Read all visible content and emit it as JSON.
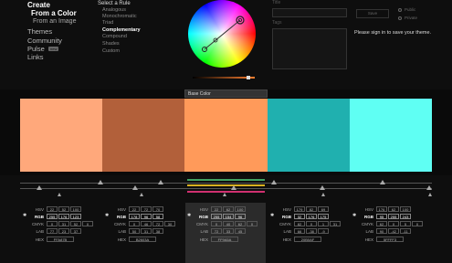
{
  "nav": {
    "create": "Create",
    "from_color": "From a Color",
    "from_image": "From an Image",
    "themes": "Themes",
    "community": "Community",
    "pulse": "Pulse",
    "pulse_badge": "new",
    "links": "Links"
  },
  "rules": {
    "title": "Select a Rule",
    "items": [
      "Analogous",
      "Monochromatic",
      "Triad",
      "Complementary",
      "Compound",
      "Shades",
      "Custom"
    ],
    "active_index": 3
  },
  "form": {
    "title_label": "Title",
    "tags_label": "Tags",
    "save_label": "Save",
    "public_label": "Public",
    "private_label": "Private",
    "signin_text": "Please sign in to save your theme."
  },
  "base_color_label": "Base Color",
  "swatches": [
    {
      "color": "#FFA87B",
      "hex": "FFA87B"
    },
    {
      "color": "#B2603A",
      "hex": "B2603A"
    },
    {
      "color": "#FF9A5A",
      "hex": "FF9A5A"
    },
    {
      "color": "#20B0AF",
      "hex": "20B0AF"
    },
    {
      "color": "#5FFFF3",
      "hex": "5FFFF3"
    }
  ],
  "values": [
    {
      "hsv": [
        "22",
        "52",
        "100"
      ],
      "rgb": [
        "255",
        "176",
        "123"
      ],
      "cmyk": [
        "0",
        "31",
        "52",
        "0"
      ],
      "lab": [
        "77",
        "23",
        "37"
      ],
      "hex": "FFA87B"
    },
    {
      "hsv": [
        "22",
        "72",
        "70"
      ],
      "rgb": [
        "178",
        "96",
        "58"
      ],
      "cmyk": [
        "0",
        "46",
        "72",
        "30"
      ],
      "lab": [
        "50",
        "31",
        "38"
      ],
      "hex": "B2603A"
    },
    {
      "hsv": [
        "22",
        "62",
        "100"
      ],
      "rgb": [
        "255",
        "154",
        "96"
      ],
      "cmyk": [
        "0",
        "40",
        "62",
        "0"
      ],
      "lab": [
        "72",
        "33",
        "45"
      ],
      "hex": "FF9A5A"
    },
    {
      "hsv": [
        "179",
        "82",
        "69"
      ],
      "rgb": [
        "32",
        "176",
        "175"
      ],
      "cmyk": [
        "82",
        "0",
        "1",
        "31"
      ],
      "lab": [
        "66",
        "-38",
        "-9"
      ],
      "hex": "20B0AF"
    },
    {
      "hsv": [
        "176",
        "62",
        "100"
      ],
      "rgb": [
        "95",
        "255",
        "243"
      ],
      "cmyk": [
        "62",
        "0",
        "5",
        "0"
      ],
      "lab": [
        "90",
        "-42",
        "-11"
      ],
      "hex": "5FFFF3"
    }
  ],
  "row_labels": {
    "hsv": "HSV",
    "rgb": "RGB",
    "cmyk": "CMYK",
    "lab": "LAB",
    "hex": "HEX"
  }
}
